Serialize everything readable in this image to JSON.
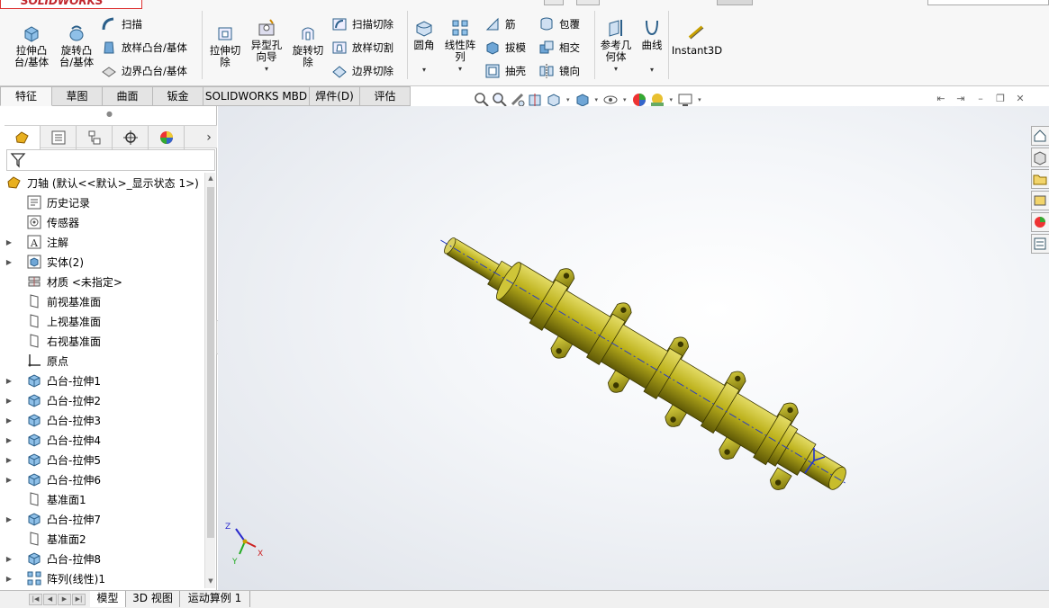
{
  "app": {
    "logo_text": "SOLIDWORKS"
  },
  "ribbon": {
    "extrude_boss": "拉伸凸\n台/基体",
    "revolve_boss": "旋转凸\n台/基体",
    "sweep": "扫描",
    "loft_boss": "放样凸台/基体",
    "boundary_boss": "边界凸台/基体",
    "extrude_cut": "拉伸切\n除",
    "hole_wizard": "异型孔\n向导",
    "revolve_cut": "旋转切\n除",
    "swept_cut": "扫描切除",
    "lofted_cut": "放样切割",
    "boundary_cut": "边界切除",
    "fillet": "圆角",
    "linear_pattern": "线性阵\n列",
    "rib": "筋",
    "draft": "拔模",
    "shell": "抽壳",
    "wrap": "包覆",
    "intersect": "相交",
    "mirror": "镜向",
    "ref_geometry": "参考几\n何体",
    "curves": "曲线",
    "instant3d": "Instant3D"
  },
  "command_tabs": [
    "特征",
    "草图",
    "曲面",
    "钣金",
    "SOLIDWORKS MBD",
    "焊件(D)",
    "评估"
  ],
  "tree": {
    "root": "刀轴  (默认<<默认>_显示状态 1>)",
    "items": [
      {
        "label": "历史记录",
        "icon": "history-icon",
        "expand": false
      },
      {
        "label": "传感器",
        "icon": "sensor-icon",
        "expand": false
      },
      {
        "label": "注解",
        "icon": "annotation-icon",
        "expand": true
      },
      {
        "label": "实体(2)",
        "icon": "solid-bodies-icon",
        "expand": true
      },
      {
        "label": "材质 <未指定>",
        "icon": "material-icon",
        "expand": false
      },
      {
        "label": "前视基准面",
        "icon": "plane-icon",
        "expand": false
      },
      {
        "label": "上视基准面",
        "icon": "plane-icon",
        "expand": false
      },
      {
        "label": "右视基准面",
        "icon": "plane-icon",
        "expand": false
      },
      {
        "label": "原点",
        "icon": "origin-icon",
        "expand": false
      },
      {
        "label": "凸台-拉伸1",
        "icon": "extrude-feature-icon",
        "expand": true
      },
      {
        "label": "凸台-拉伸2",
        "icon": "extrude-feature-icon",
        "expand": true
      },
      {
        "label": "凸台-拉伸3",
        "icon": "extrude-feature-icon",
        "expand": true
      },
      {
        "label": "凸台-拉伸4",
        "icon": "extrude-feature-icon",
        "expand": true
      },
      {
        "label": "凸台-拉伸5",
        "icon": "extrude-feature-icon",
        "expand": true
      },
      {
        "label": "凸台-拉伸6",
        "icon": "extrude-feature-icon",
        "expand": true
      },
      {
        "label": "基准面1",
        "icon": "plane-icon",
        "expand": false
      },
      {
        "label": "凸台-拉伸7",
        "icon": "extrude-feature-icon",
        "expand": true
      },
      {
        "label": "基准面2",
        "icon": "plane-icon",
        "expand": false
      },
      {
        "label": "凸台-拉伸8",
        "icon": "extrude-feature-icon",
        "expand": true
      },
      {
        "label": "阵列(线性)1",
        "icon": "linear-pattern-icon",
        "expand": true
      }
    ]
  },
  "bottom_tabs": [
    "模型",
    "3D 视图",
    "运动算例 1"
  ],
  "triad": {
    "x": "X",
    "y": "Y",
    "z": "Z"
  },
  "colors": {
    "part": "#b8ae1a",
    "part_dark": "#6e6808",
    "part_light": "#ded65a",
    "accent": "#c1272d"
  }
}
